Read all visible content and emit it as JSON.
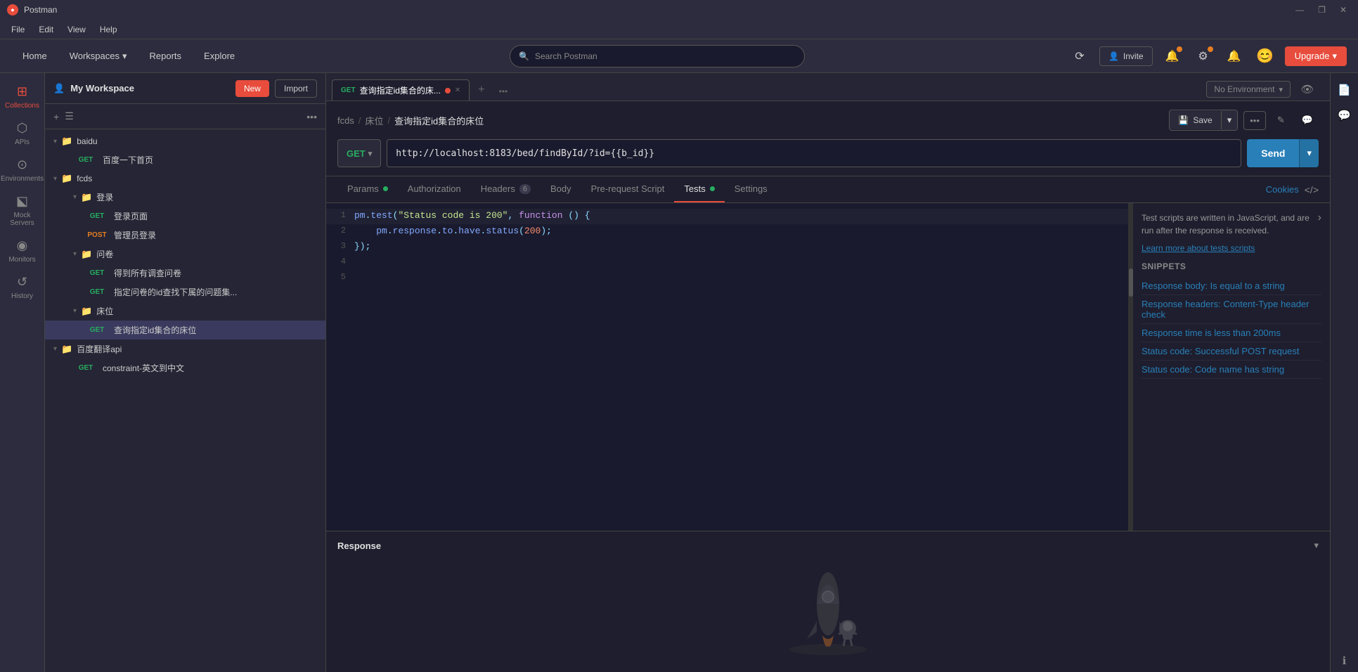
{
  "app": {
    "title": "Postman",
    "title_bar_controls": [
      "—",
      "❐",
      "✕"
    ]
  },
  "menu": {
    "items": [
      "File",
      "Edit",
      "View",
      "Help"
    ]
  },
  "top_nav": {
    "home": "Home",
    "workspaces": "Workspaces",
    "reports": "Reports",
    "explore": "Explore",
    "search_placeholder": "Search Postman",
    "invite": "Invite",
    "upgrade": "Upgrade"
  },
  "workspace": {
    "label": "My Workspace",
    "new_btn": "New",
    "import_btn": "Import"
  },
  "sidebar_icons": [
    {
      "id": "collections",
      "label": "Collections",
      "icon": "⊞",
      "active": true
    },
    {
      "id": "apis",
      "label": "APIs",
      "icon": "⬡"
    },
    {
      "id": "environments",
      "label": "Environments",
      "icon": "⊙"
    },
    {
      "id": "mock-servers",
      "label": "Mock Servers",
      "icon": "⬕"
    },
    {
      "id": "monitors",
      "label": "Monitors",
      "icon": "◉"
    },
    {
      "id": "history",
      "label": "History",
      "icon": "↺"
    }
  ],
  "collections_tree": [
    {
      "id": "baidu",
      "type": "folder-root",
      "label": "baidu",
      "level": 0,
      "expanded": true
    },
    {
      "id": "baidu-1",
      "type": "request",
      "method": "GET",
      "label": "百度一下首页",
      "level": 1
    },
    {
      "id": "fcds",
      "type": "folder-root",
      "label": "fcds",
      "level": 0,
      "expanded": true
    },
    {
      "id": "login-folder",
      "type": "folder",
      "label": "登录",
      "level": 1,
      "expanded": true
    },
    {
      "id": "login-get",
      "type": "request",
      "method": "GET",
      "label": "登录页面",
      "level": 2
    },
    {
      "id": "login-post",
      "type": "request",
      "method": "POST",
      "label": "管理员登录",
      "level": 2
    },
    {
      "id": "questionnaire-folder",
      "type": "folder",
      "label": "问卷",
      "level": 1,
      "expanded": true
    },
    {
      "id": "q-get-1",
      "type": "request",
      "method": "GET",
      "label": "得到所有调查问卷",
      "level": 2
    },
    {
      "id": "q-get-2",
      "type": "request",
      "method": "GET",
      "label": "指定问卷的id查找下属的问题集...",
      "level": 2
    },
    {
      "id": "bed-folder",
      "type": "folder",
      "label": "床位",
      "level": 1,
      "expanded": true
    },
    {
      "id": "bed-get",
      "type": "request",
      "method": "GET",
      "label": "查询指定id集合的床位",
      "level": 2,
      "selected": true
    },
    {
      "id": "baidu-translate",
      "type": "folder-root",
      "label": "百度翻译api",
      "level": 0,
      "expanded": true
    },
    {
      "id": "translate-get",
      "type": "request",
      "method": "GET",
      "label": "constraint-英文到中文",
      "level": 1
    }
  ],
  "tabs": [
    {
      "id": "bed-tab",
      "method": "GET",
      "label": "查询指定id集合的床...",
      "active": true,
      "has_dot": true
    }
  ],
  "breadcrumb": {
    "parts": [
      "fcds",
      "床位",
      "查询指定id集合的床位"
    ],
    "sep": "/"
  },
  "request": {
    "method": "GET",
    "url": "http://localhost:8183/bed/findById/?id={{b_id}}",
    "send_btn": "Send"
  },
  "request_tabs": [
    {
      "id": "params",
      "label": "Params",
      "has_dot": true,
      "dot_color": "green"
    },
    {
      "id": "authorization",
      "label": "Authorization"
    },
    {
      "id": "headers",
      "label": "Headers",
      "count": "6"
    },
    {
      "id": "body",
      "label": "Body"
    },
    {
      "id": "pre-request",
      "label": "Pre-request Script"
    },
    {
      "id": "tests",
      "label": "Tests",
      "active": true,
      "has_dot": true,
      "dot_color": "green"
    },
    {
      "id": "settings",
      "label": "Settings"
    }
  ],
  "cookies_btn": "Cookies",
  "editor": {
    "lines": [
      {
        "num": "1",
        "content": "pm.test(\"Status code is 200\", function () {"
      },
      {
        "num": "2",
        "content": "    pm.response.to.have.status(200);"
      },
      {
        "num": "3",
        "content": "});"
      },
      {
        "num": "4",
        "content": ""
      },
      {
        "num": "5",
        "content": ""
      }
    ]
  },
  "snippets": {
    "info_text": "Test scripts are written in JavaScript, and are run after the response is received.",
    "learn_link": "Learn more about tests scripts",
    "title": "SNIPPETS",
    "items": [
      "Response body: Is equal to a string",
      "Response headers: Content-Type header check",
      "Response time is less than 200ms",
      "Status code: Successful POST request",
      "Status code: Code name has string"
    ]
  },
  "response": {
    "title": "Response"
  },
  "save_btn": "Save",
  "colors": {
    "accent": "#e74c3c",
    "blue": "#2980b9",
    "green": "#27ae60",
    "orange": "#e67e22"
  }
}
